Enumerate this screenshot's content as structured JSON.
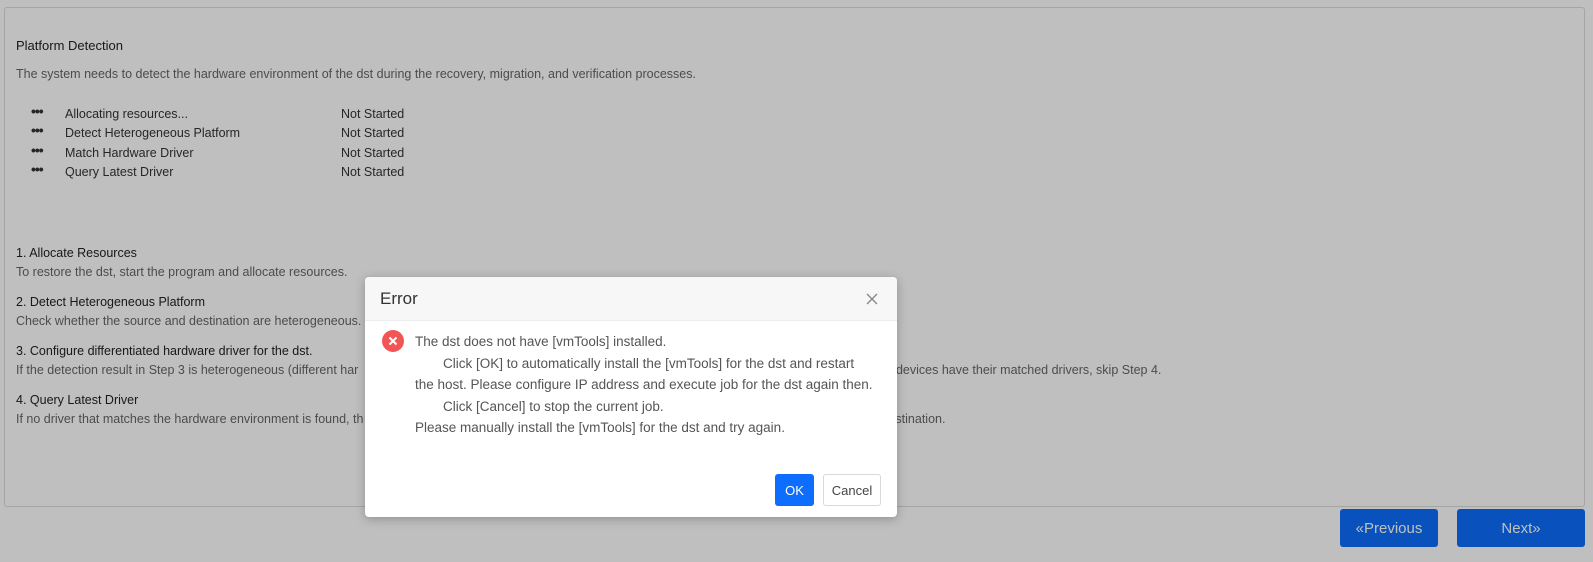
{
  "page": {
    "heading": "Platform Detection",
    "description": "The system needs to detect the hardware environment of the dst during the recovery, migration, and verification processes."
  },
  "tasks": [
    {
      "name": "Allocating resources...",
      "status": "Not Started"
    },
    {
      "name": "Detect Heterogeneous Platform",
      "status": "Not Started"
    },
    {
      "name": "Match Hardware Driver",
      "status": "Not Started"
    },
    {
      "name": "Query Latest Driver",
      "status": "Not Started"
    }
  ],
  "steps": [
    {
      "title": "1. Allocate Resources",
      "text": "To restore the dst, start the program and allocate resources."
    },
    {
      "title": "2. Detect Heterogeneous Platform",
      "text": "Check whether the source and destination are heterogeneous."
    },
    {
      "title": "3. Configure differentiated hardware driver for the dst.",
      "text": "If the detection result in Step 3 is heterogeneous (different har",
      "text_end": "em driver library. If all hardware devices have their matched drivers, skip Step 4."
    },
    {
      "title": "4. Query Latest Driver",
      "text": "If no driver that matches the hardware environment is found, th",
      "text_end": "vironment of the destination."
    }
  ],
  "nav": {
    "previous_label": "«Previous",
    "next_label": "Next»"
  },
  "dialog": {
    "title": "Error",
    "line1": "The dst does not have [vmTools] installed.",
    "line2": "Click [OK] to automatically install the [vmTools] for the dst and restart the host. Please configure IP address and execute job for the dst again then.",
    "line3": "Click [Cancel] to stop the current job.",
    "line4": "Please manually install the [vmTools] for the dst and try again.",
    "ok_label": "OK",
    "cancel_label": "Cancel"
  },
  "colors": {
    "primary": "#0d6efd",
    "error": "#f15555",
    "overlay": "rgba(0,0,0,0.25)"
  }
}
